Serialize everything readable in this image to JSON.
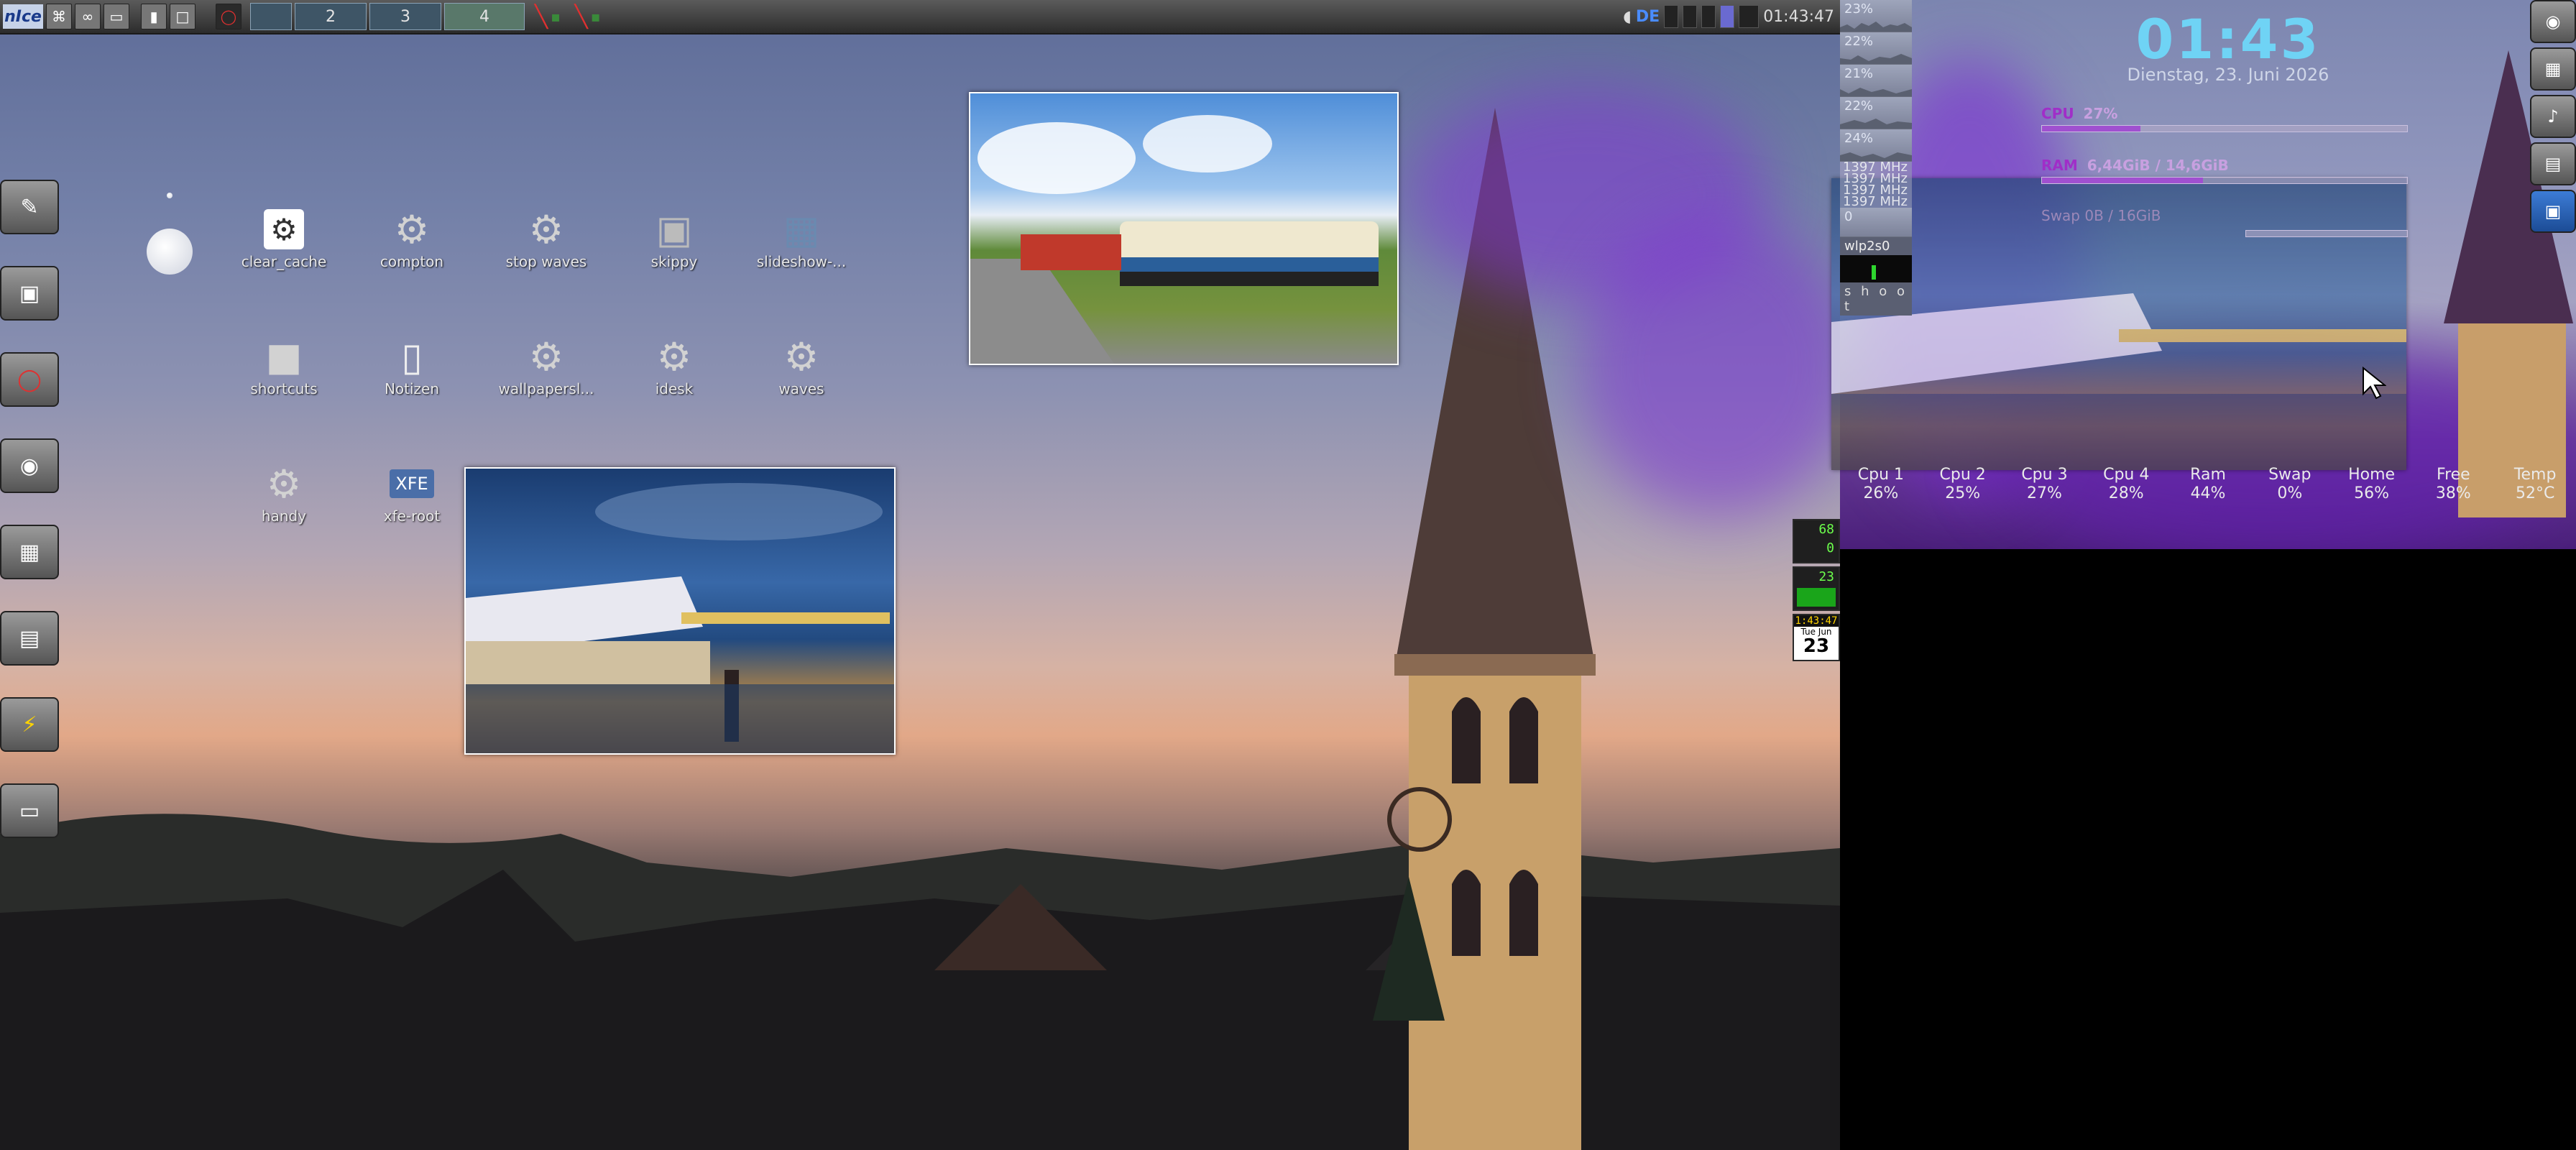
{
  "taskbar": {
    "logo_text": "nIce",
    "workspaces": [
      {
        "label": "2",
        "active": false
      },
      {
        "label": "3",
        "active": false
      },
      {
        "label": "4",
        "active": true
      }
    ],
    "keyboard_layout": "DE",
    "clock": "01:43:47"
  },
  "desktop_icons": [
    {
      "label": "clear_cache",
      "icon": "settings-icon"
    },
    {
      "label": "compton",
      "icon": "gears-icon"
    },
    {
      "label": "stop waves",
      "icon": "gears-icon"
    },
    {
      "label": "skippy",
      "icon": "window-icon"
    },
    {
      "label": "slideshow-...",
      "icon": "image-icon"
    },
    {
      "label": "shortcuts",
      "icon": "folder-icon"
    },
    {
      "label": "Notizen",
      "icon": "document-icon"
    },
    {
      "label": "wallpapersl...",
      "icon": "gears-icon"
    },
    {
      "label": "idesk",
      "icon": "gears-icon"
    },
    {
      "label": "waves",
      "icon": "gears-icon"
    },
    {
      "label": "handy",
      "icon": "gears-icon"
    },
    {
      "label": "xfe-root",
      "icon": "xfe-icon"
    }
  ],
  "conky": {
    "time": "01:43",
    "date": "Dienstag, 23. Juni 2026",
    "cpu_label": "CPU",
    "cpu_value": "27%",
    "cpu_fraction": 0.27,
    "ram_label": "RAM",
    "ram_value": "6,44GiB / 14,6GiB",
    "ram_fraction": 0.44,
    "swap_text": "Swap 0B / 16GiB"
  },
  "monitor_panel": {
    "cpu_percents": [
      "23%",
      "22%",
      "21%",
      "22%",
      "24%"
    ],
    "mhz": [
      "1397 MHz",
      "1397 MHz",
      "1397 MHz",
      "1397 MHz"
    ],
    "net_value": "0",
    "wlan": "wlp2s0",
    "shoot": "s h o o t"
  },
  "bottom_stats": [
    {
      "label": "Cpu 1",
      "value": "26%"
    },
    {
      "label": "Cpu 2",
      "value": "25%"
    },
    {
      "label": "Cpu 3",
      "value": "27%"
    },
    {
      "label": "Cpu 4",
      "value": "28%"
    },
    {
      "label": "Ram",
      "value": "44%"
    },
    {
      "label": "Swap",
      "value": "0%"
    },
    {
      "label": "Home",
      "value": "56%"
    },
    {
      "label": "Free",
      "value": "38%"
    },
    {
      "label": "Temp",
      "value": "52°C"
    }
  ],
  "dockapps": {
    "battery_top": "68",
    "battery_bottom": "0",
    "load": "23",
    "mini_clock": "1:43:47",
    "cal_month": "Tue Jun",
    "cal_day": "23"
  },
  "colors": {
    "clock_cyan": "#6fd3f5",
    "conky_purple": "#a02ec8",
    "led_green": "#6cff4c"
  }
}
